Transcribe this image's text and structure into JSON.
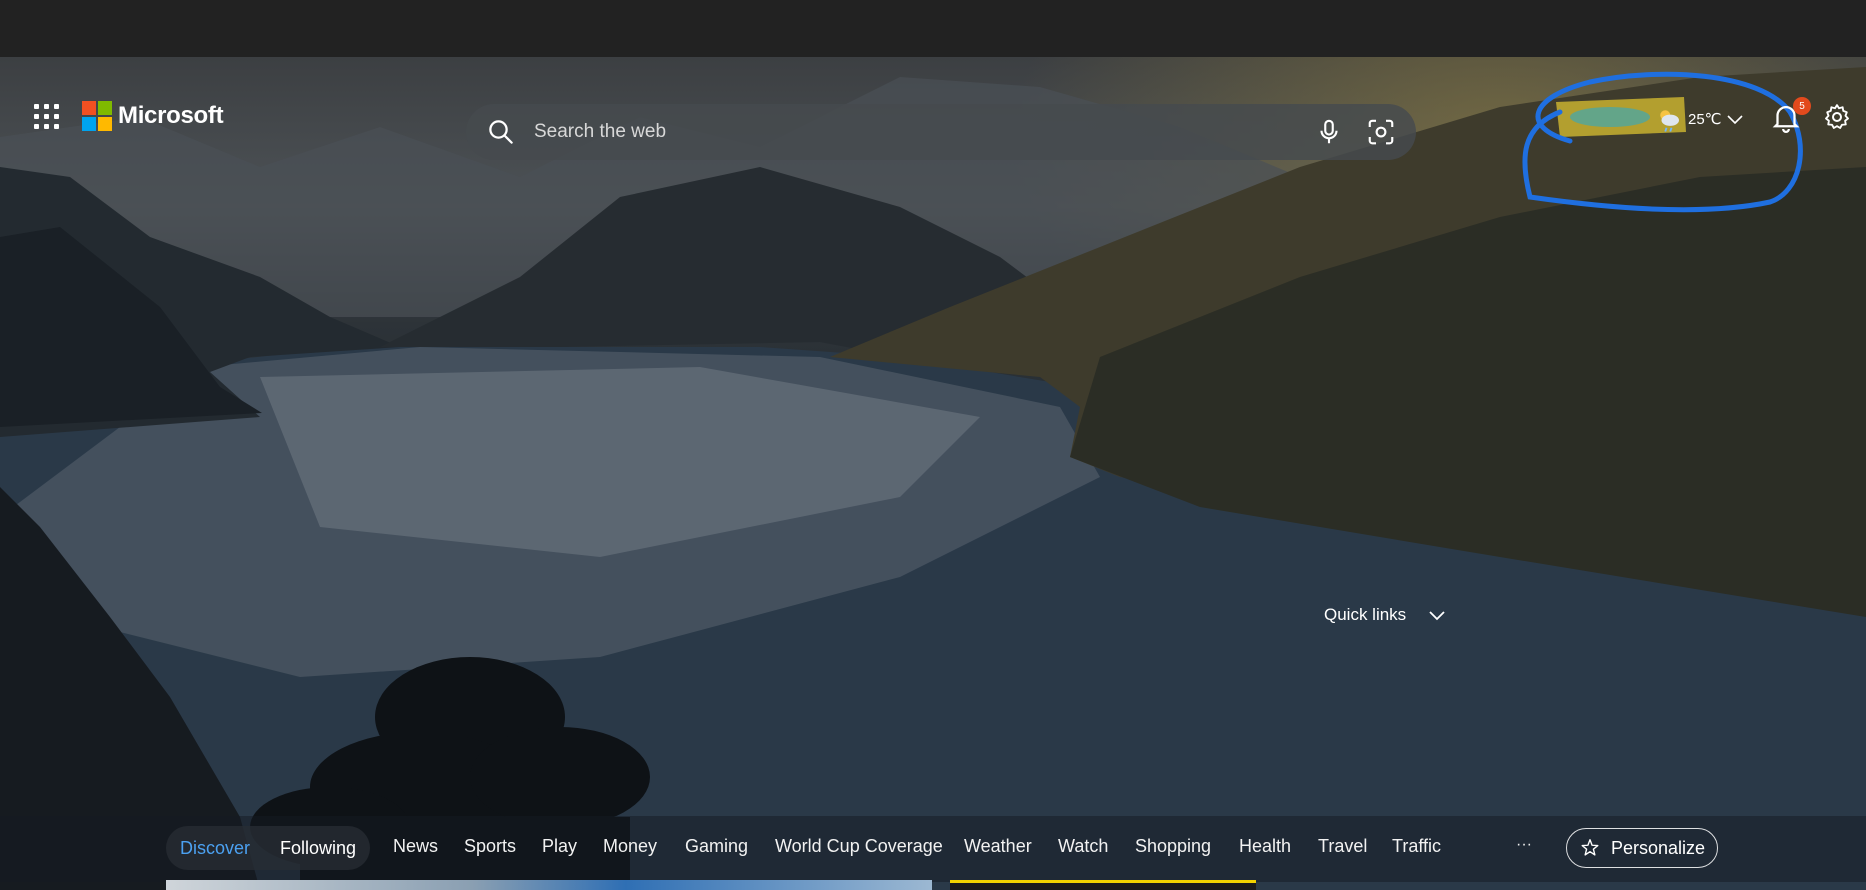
{
  "brand": {
    "name": "Microsoft",
    "logo_colors": [
      "#f25022",
      "#7fba00",
      "#00a4ef",
      "#ffb900"
    ]
  },
  "search": {
    "placeholder": "Search the web"
  },
  "weather": {
    "temperature": "25℃",
    "icon": "partly-cloudy-rain-icon"
  },
  "notifications": {
    "count": "5",
    "badge_color": "#e24a1d"
  },
  "quick_links": {
    "label": "Quick links"
  },
  "feed_tabs": [
    {
      "label": "Discover",
      "active": true
    },
    {
      "label": "Following",
      "active": false
    }
  ],
  "nav_tabs": [
    "News",
    "Sports",
    "Play",
    "Money",
    "Gaming",
    "World Cup Coverage",
    "Weather",
    "Watch",
    "Shopping",
    "Health",
    "Travel",
    "Traffic"
  ],
  "more_label": "···",
  "personalize_label": "Personalize",
  "colors": {
    "accent": "#4ba0f0",
    "annotation_blue": "#1f6fe0",
    "annotation_highlight": "#c8b130"
  }
}
